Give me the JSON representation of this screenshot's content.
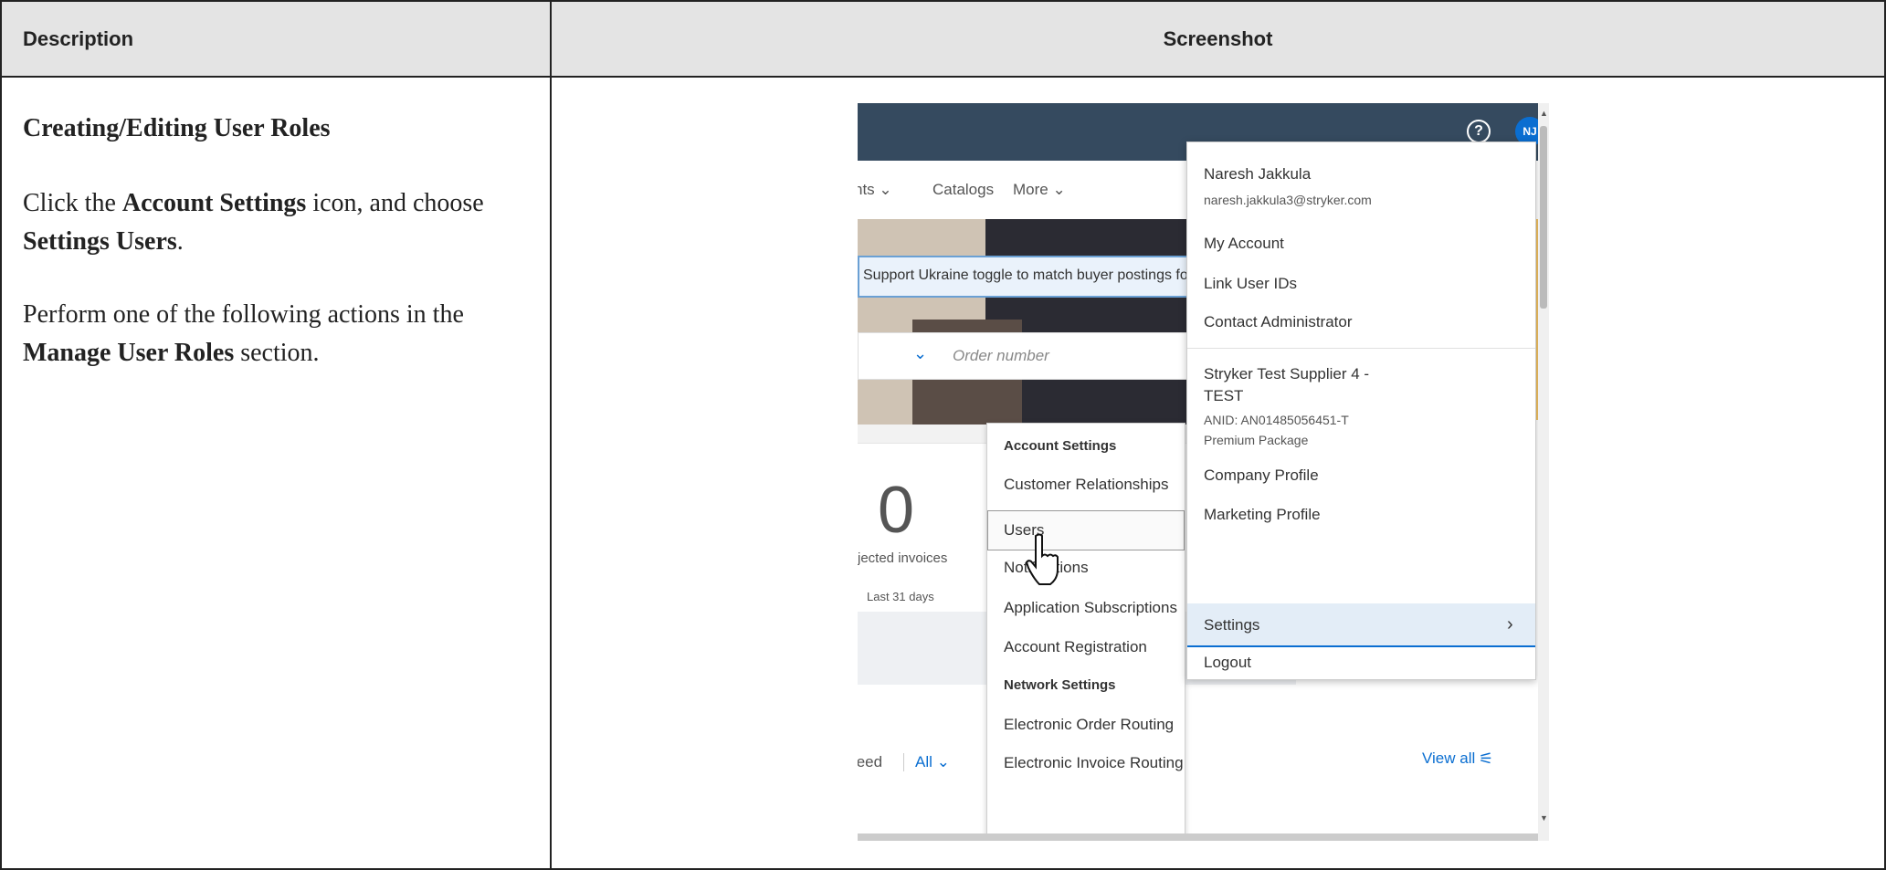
{
  "table": {
    "header_description": "Description",
    "header_screenshot": "Screenshot"
  },
  "description": {
    "title": "Creating/Editing User Roles",
    "p1_a": "Click the ",
    "p1_b": "Account Settings",
    "p1_c": " icon, and choose ",
    "p1_d": "Settings  Users",
    "p1_e": ".",
    "p2_a": "Perform one of the following actions in the ",
    "p2_b": "Manage User Roles",
    "p2_c": " section."
  },
  "screenshot": {
    "help_glyph": "?",
    "avatar_initials": "NJ",
    "nav": {
      "item1": "nts ⌄",
      "item2": "Catalogs",
      "item3": "More ⌄"
    },
    "banner_text": "Support Ukraine toggle to match buyer postings for urgently",
    "order_placeholder": "Order number",
    "tile_value": "0",
    "tile_label": "jected invoices",
    "tile_period": "Last 31 days",
    "feed_label": "feed",
    "feed_filter": "All ⌄",
    "view_all": "View all",
    "account_menu": {
      "user_name": "Naresh Jakkula",
      "user_email": "naresh.jakkula3@stryker.com",
      "my_account": "My Account",
      "link_user_ids": "Link User IDs",
      "contact_admin": "Contact Administrator",
      "company_line1": "Stryker Test Supplier 4 -",
      "company_line2": "TEST",
      "anid": "ANID: AN01485056451-T",
      "package": "Premium Package",
      "company_profile": "Company Profile",
      "marketing_profile": "Marketing Profile",
      "settings": "Settings",
      "logout": "Logout"
    },
    "settings_submenu": {
      "account_settings_header": "Account Settings",
      "customer_relationships": "Customer Relationships",
      "users": "Users",
      "notifications": "Notifications",
      "application_subscriptions": "Application Subscriptions",
      "account_registration": "Account Registration",
      "network_settings_header": "Network Settings",
      "electronic_order_routing": "Electronic Order Routing",
      "electronic_invoice_routing": "Electronic Invoice Routing"
    }
  },
  "colors": {
    "header_bg": "#e4e4e4",
    "topbar": "#354a5f",
    "accent": "#0a6ed1"
  }
}
